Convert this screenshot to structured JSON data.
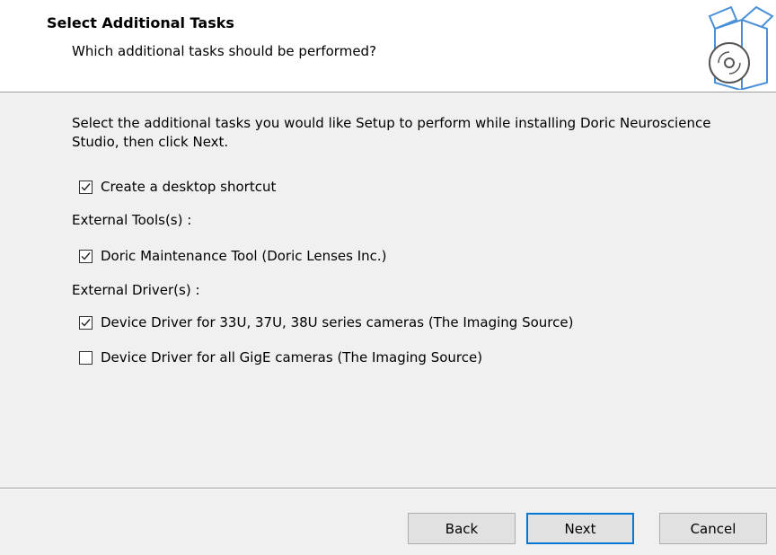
{
  "header": {
    "title": "Select Additional Tasks",
    "subtitle": "Which additional tasks should be performed?",
    "icon": "setup-box-disc-icon"
  },
  "content": {
    "description": "Select the additional tasks you would like Setup to perform while installing Doric Neuroscience Studio, then click Next.",
    "tasks": [
      {
        "label": "Create a desktop shortcut",
        "checked": true
      }
    ],
    "groups": [
      {
        "label": "External Tools(s) :",
        "items": [
          {
            "label": "Doric Maintenance Tool (Doric Lenses Inc.)",
            "checked": true
          }
        ]
      },
      {
        "label": "External Driver(s) :",
        "items": [
          {
            "label": "Device Driver for 33U, 37U, 38U series cameras (The Imaging Source)",
            "checked": true
          },
          {
            "label": "Device Driver for all GigE cameras (The Imaging Source)",
            "checked": false
          }
        ]
      }
    ]
  },
  "footer": {
    "back_label": "Back",
    "next_label": "Next",
    "cancel_label": "Cancel",
    "focus_color": "#0078d7"
  }
}
